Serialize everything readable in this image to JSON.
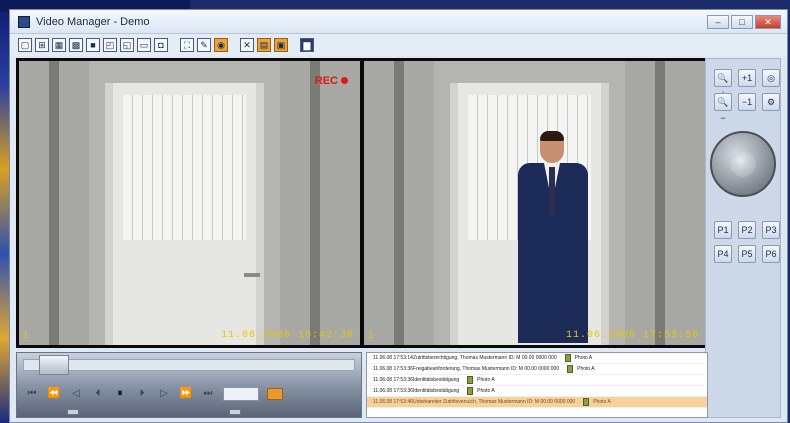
{
  "window": {
    "title": "Video Manager - Demo"
  },
  "window_buttons": [
    "–",
    "□",
    "✕"
  ],
  "toolbar": {
    "buttons": [
      {
        "name": "layout-1x1-icon",
        "glyph": "▢"
      },
      {
        "name": "layout-2x2-icon",
        "glyph": "⊞"
      },
      {
        "name": "layout-3x3-icon",
        "glyph": "▦"
      },
      {
        "name": "layout-4x4-icon",
        "glyph": "▩"
      },
      {
        "name": "layout-fill-icon",
        "glyph": "■"
      },
      {
        "name": "layout-1-5-icon",
        "glyph": "◰"
      },
      {
        "name": "layout-1-7-icon",
        "glyph": "◱"
      },
      {
        "name": "layout-wide-icon",
        "glyph": "▭"
      },
      {
        "name": "layout-grid-icon",
        "glyph": "◘"
      },
      {
        "name": "fullscreen-icon",
        "glyph": "⛶"
      },
      {
        "name": "link-icon",
        "glyph": "✎"
      },
      {
        "name": "record-active-icon",
        "glyph": "◉"
      },
      {
        "name": "tools-icon",
        "glyph": "✕"
      },
      {
        "name": "panel-toggle-icon",
        "glyph": "▤"
      },
      {
        "name": "folder-active-icon",
        "glyph": "▣"
      },
      {
        "name": "save-icon",
        "glyph": "▆"
      }
    ]
  },
  "cameras": [
    {
      "number": "1",
      "timestamp": "11.06.2008   10:42:30",
      "recording": true,
      "rec_label": "REC"
    },
    {
      "number": "1",
      "timestamp": "11.06.2008   17:53:56",
      "recording": false,
      "rec_label": ""
    }
  ],
  "ptz": {
    "zoom_buttons": [
      "🔍+",
      "+1",
      "◎",
      "🔍−",
      "−1",
      "⚙"
    ],
    "preset_buttons": [
      "P1",
      "P2",
      "P3",
      "P4",
      "P5",
      "P6"
    ]
  },
  "playback": {
    "controls": [
      "⏮",
      "⏪",
      "◁",
      "⏴",
      "⏸",
      "⏵",
      "▷",
      "⏩",
      "⏭"
    ]
  },
  "events": [
    {
      "time": "11.06.08 17:53:14",
      "text": "Zutrittsberechtigung, Thomas Mustermann ID: M 00.00 0000 000",
      "photo": "Photo A"
    },
    {
      "time": "11.06.08 17:53:36",
      "text": "Freigabeanforderung, Thomas Mustermann ID: M 00.00 0000 000",
      "photo": "Photo A"
    },
    {
      "time": "11.06.08 17:53:36",
      "text": "Identitätsbestätigung",
      "photo": "Photo A"
    },
    {
      "time": "11.06.08 17:53:36",
      "text": "Identitätsbestätigung",
      "photo": "Photo A"
    },
    {
      "time": "11.06.08 17:53:46",
      "text": "Unbekannter Zutrittsversuch, Thomas Mustermann ID: M 00.00 0000 000",
      "photo": "Photo A",
      "selected": true
    }
  ],
  "colors": {
    "accent": "#e8a43a",
    "rec": "#e01818",
    "timestamp": "#e8c800"
  }
}
